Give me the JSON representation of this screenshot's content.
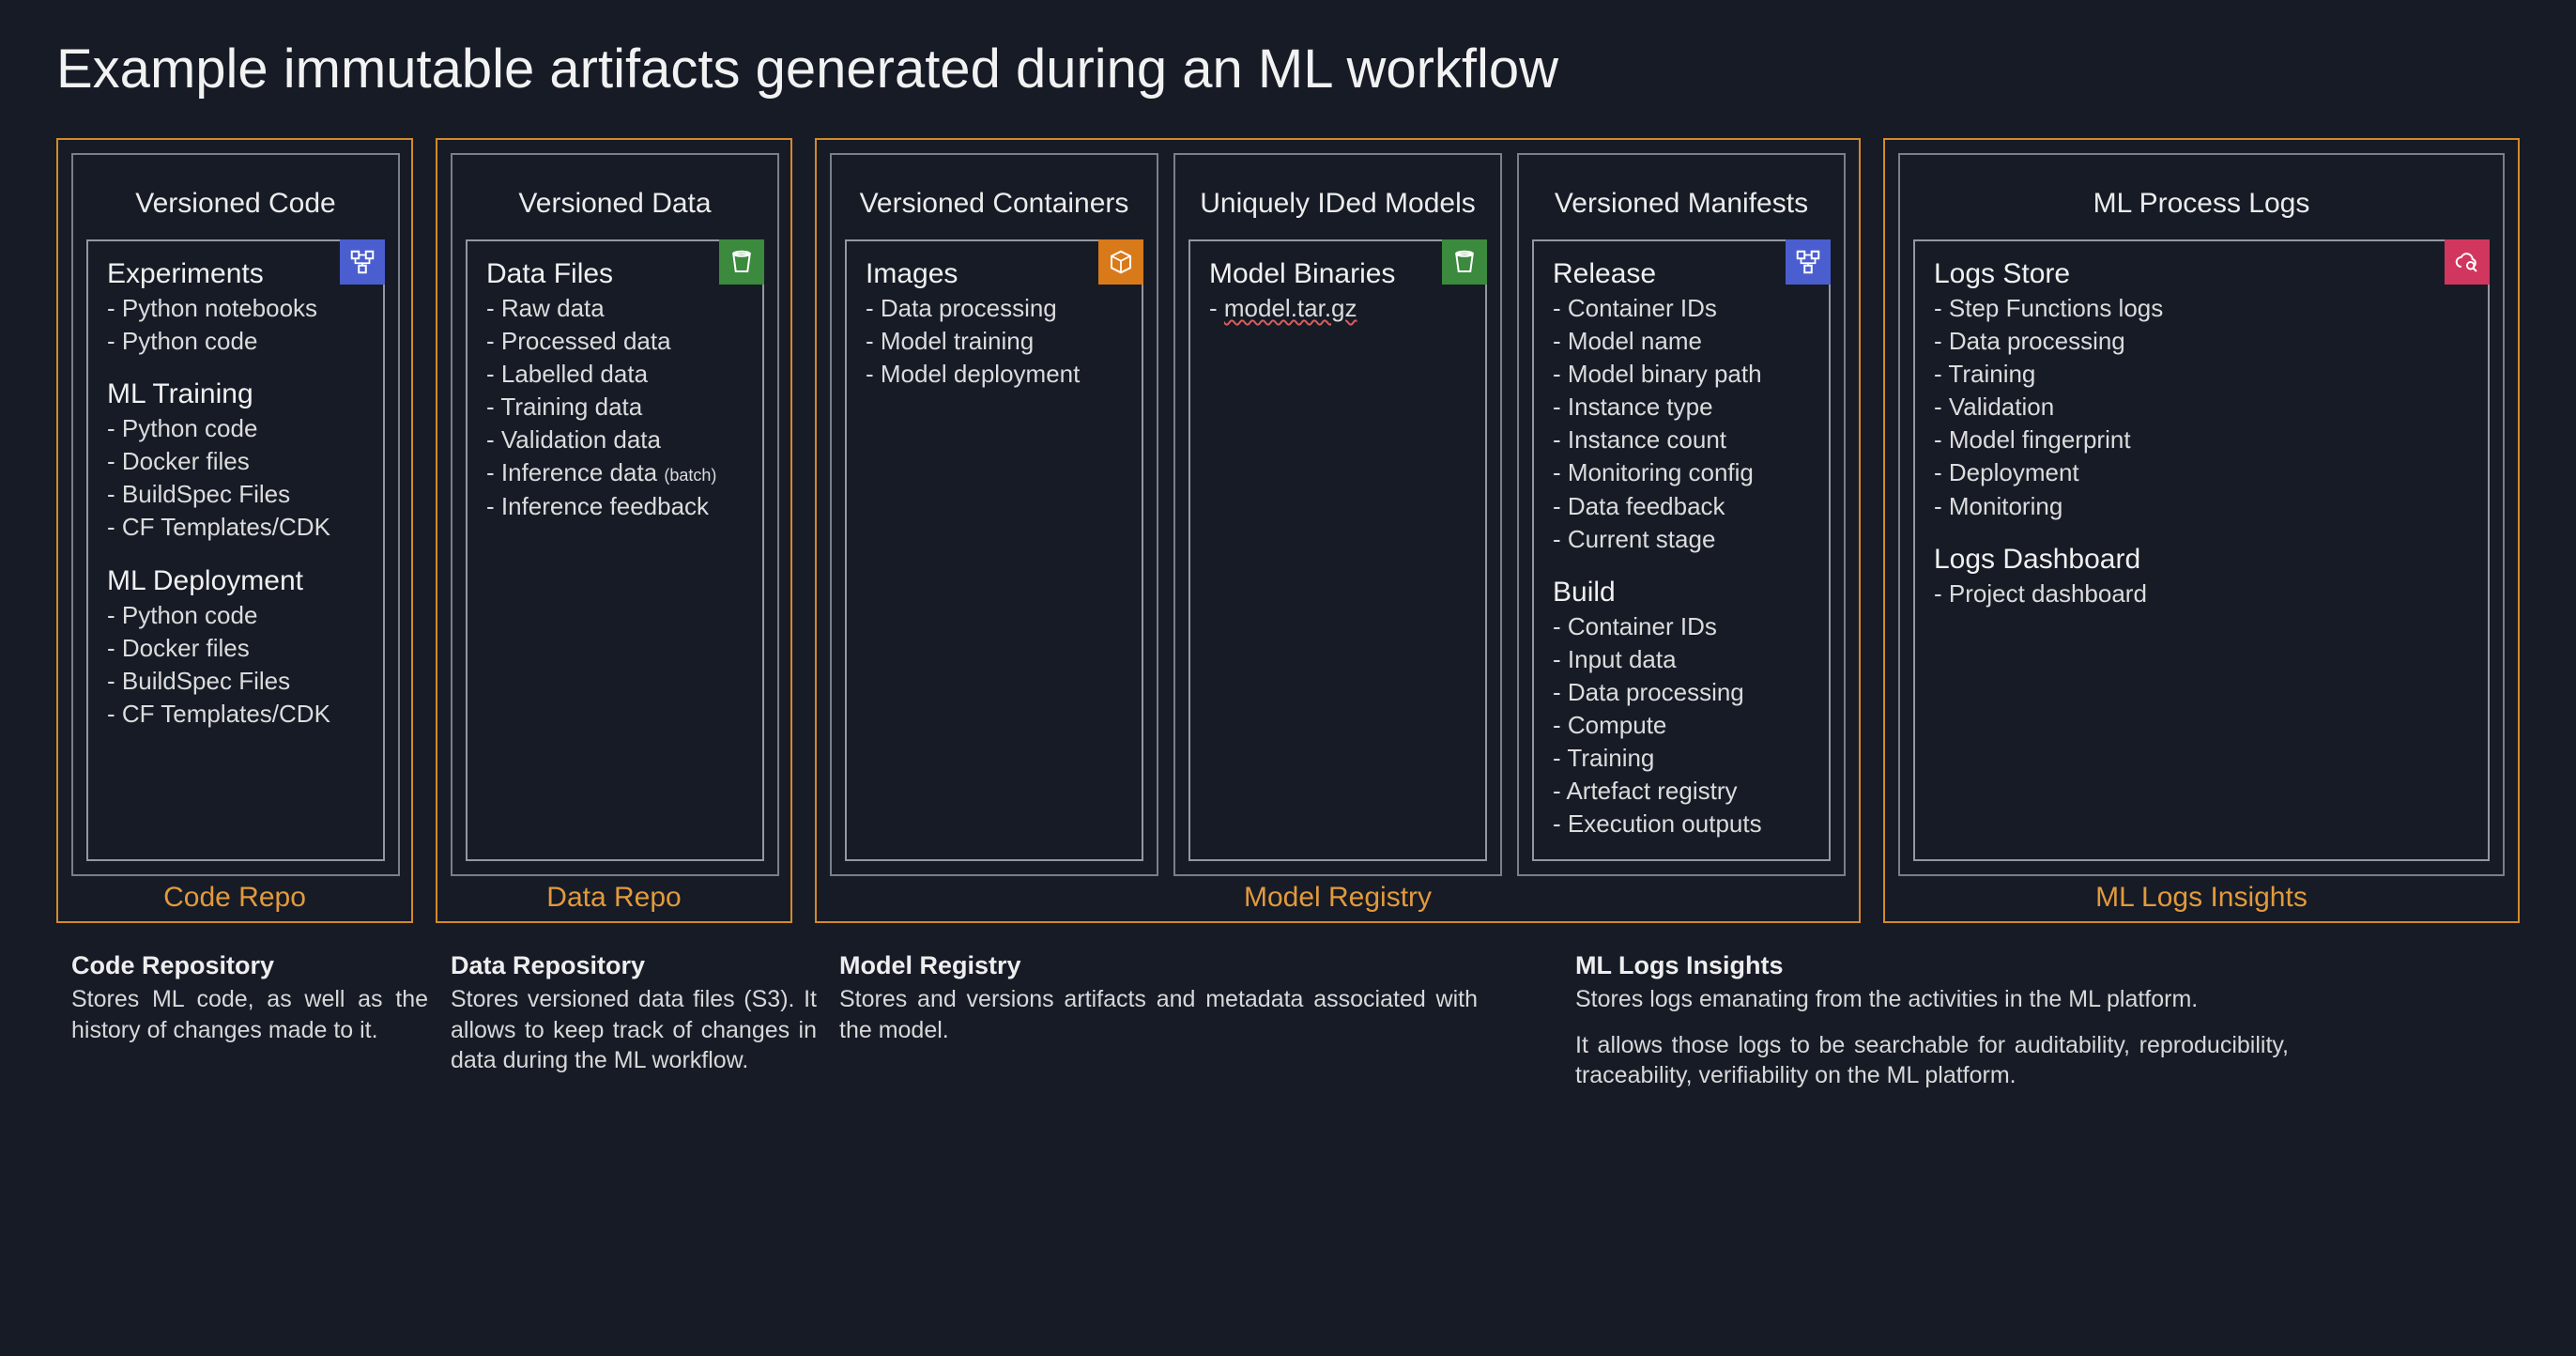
{
  "title": "Example immutable artifacts generated during an ML workflow",
  "groups": [
    {
      "label": "Code Repo"
    },
    {
      "label": "Data Repo"
    },
    {
      "label": "Model Registry"
    },
    {
      "label": "ML Logs Insights"
    }
  ],
  "cols": {
    "code": {
      "title": "Versioned Code",
      "sections": [
        {
          "head": "Experiments",
          "items": [
            "Python notebooks",
            "Python code"
          ]
        },
        {
          "head": "ML Training",
          "items": [
            "Python code",
            "Docker files",
            "BuildSpec Files",
            "CF Templates/CDK"
          ]
        },
        {
          "head": "ML Deployment",
          "items": [
            "Python code",
            "Docker files",
            "BuildSpec Files",
            "CF Templates/CDK"
          ]
        }
      ]
    },
    "data": {
      "title": "Versioned Data",
      "sections": [
        {
          "head": "Data Files",
          "items": [
            "Raw data",
            "Processed data",
            "Labelled data",
            "Training data",
            "Validation data",
            "Inference data",
            "Inference feedback"
          ],
          "inline_note_index": 5,
          "inline_note": "(batch)"
        }
      ]
    },
    "containers": {
      "title": "Versioned Containers",
      "sections": [
        {
          "head": "Images",
          "items": [
            "Data processing",
            "Model training",
            "Model deployment"
          ]
        }
      ]
    },
    "models": {
      "title": "Uniquely IDed Models",
      "sections": [
        {
          "head": "Model Binaries",
          "items_spellcheck": [
            "model.tar.gz"
          ]
        }
      ]
    },
    "manifests": {
      "title": "Versioned Manifests",
      "sections": [
        {
          "head": "Release",
          "items": [
            "Container IDs",
            "Model name",
            "Model binary path",
            "Instance type",
            "Instance count",
            "Monitoring config",
            "Data feedback",
            "Current stage"
          ]
        },
        {
          "head": "Build",
          "items": [
            "Container IDs",
            "Input data",
            "Data processing",
            "Compute",
            "Training",
            "Artefact registry",
            "Execution outputs"
          ]
        }
      ]
    },
    "logs": {
      "title": "ML Process Logs",
      "sections": [
        {
          "head": "Logs Store",
          "items": [
            "Step Functions logs",
            "Data processing",
            "Training",
            "Validation",
            "Model fingerprint",
            "Deployment",
            "Monitoring"
          ]
        },
        {
          "head": "Logs Dashboard",
          "items": [
            "Project dashboard"
          ]
        }
      ]
    }
  },
  "footers": {
    "code": {
      "title": "Code Repository",
      "paras": [
        "Stores ML code, as well as the history of changes made to it."
      ]
    },
    "data": {
      "title": "Data Repository",
      "paras": [
        "Stores versioned data files (S3). It allows to keep track of changes in data during the ML workflow."
      ]
    },
    "registry": {
      "title": "Model Registry",
      "paras": [
        "Stores and versions artifacts and metadata associated with the model."
      ]
    },
    "logs": {
      "title": "ML Logs Insights",
      "paras": [
        "Stores logs emanating from the activities in the ML platform.",
        "It allows those logs to be searchable for auditability, reproducibility, traceability, verifiability on the ML platform."
      ]
    }
  },
  "icons": {
    "code": "workflow-icon",
    "data": "bucket-icon",
    "containers": "container-icon",
    "models": "bucket-icon",
    "manifests": "workflow-icon",
    "logs": "cloud-search-icon"
  }
}
